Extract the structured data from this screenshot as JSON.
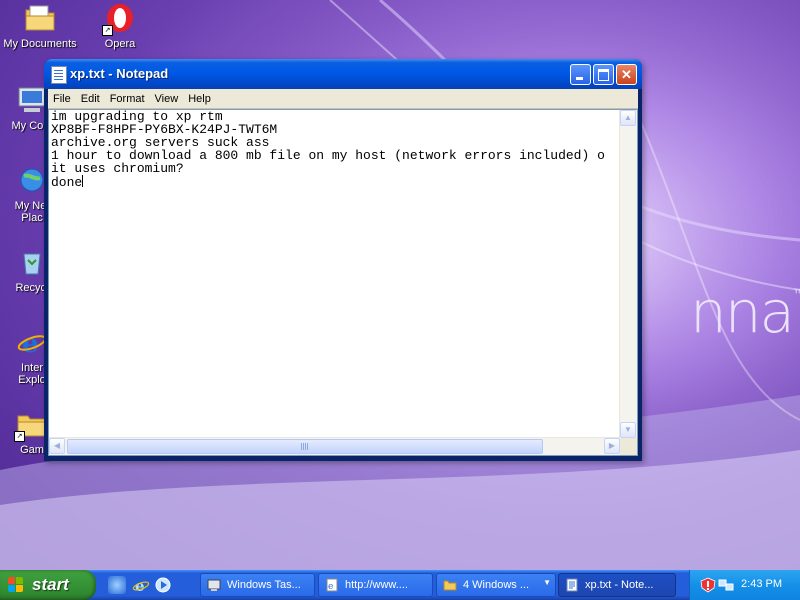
{
  "desktop": {
    "brand": "nna",
    "brand_mark": "™",
    "icons": [
      {
        "label": "My Documents",
        "name": "my-documents"
      },
      {
        "label": "Opera",
        "name": "opera"
      },
      {
        "label": "My Com",
        "name": "my-computer"
      },
      {
        "label": "My Net Plac",
        "name": "my-network-places"
      },
      {
        "label": "Recycl",
        "name": "recycle-bin"
      },
      {
        "label": "Inter Explo",
        "name": "internet-explorer"
      },
      {
        "label": "Gam",
        "name": "games"
      }
    ]
  },
  "window": {
    "title": "xp.txt - Notepad",
    "menu": [
      "File",
      "Edit",
      "Format",
      "View",
      "Help"
    ],
    "lines": [
      "im upgrading to xp rtm",
      "XP8BF-F8HPF-PY6BX-K24PJ-TWT6M",
      "archive.org servers suck ass",
      "1 hour to download a 800 mb file on my host (network errors included) o",
      "it uses chromium?",
      "done"
    ]
  },
  "taskbar": {
    "start_label": "start",
    "tasks": [
      {
        "label": "Windows Tas...",
        "icon": "task-manager-icon",
        "active": false
      },
      {
        "label": "http://www....",
        "icon": "ie-page-icon",
        "active": false
      },
      {
        "label": "4 Windows ...",
        "icon": "folder-icon",
        "active": false
      },
      {
        "label": "xp.txt - Note...",
        "icon": "notepad-icon",
        "active": true
      }
    ],
    "clock": "2:43 PM"
  },
  "colors": {
    "titlebar": "#0058e6",
    "start": "#3e9e3e",
    "taskbar": "#245edb",
    "tray": "#1590e8"
  }
}
